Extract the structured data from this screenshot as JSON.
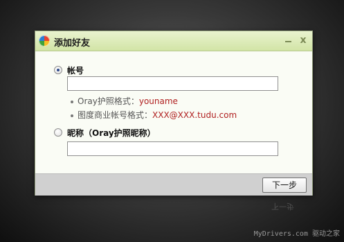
{
  "dialog": {
    "title": "添加好友",
    "app_icon": "app-logo-icon",
    "controls": {
      "minimize": "−",
      "close": "x"
    }
  },
  "form": {
    "option_account": {
      "label": "帐号",
      "selected": true,
      "input_value": "",
      "hints": [
        {
          "prefix": "Oray护照格式：",
          "value": "youname"
        },
        {
          "prefix": "图度商业帐号格式：",
          "value": "XXX@XXX.tudu.com"
        }
      ]
    },
    "option_nickname": {
      "label": "昵称（Oray护照昵称）",
      "selected": false,
      "input_value": ""
    }
  },
  "footer": {
    "next_label": "下一步"
  },
  "reflection_text": "下一步",
  "watermark": "MyDrivers.com 驱动之家",
  "colors": {
    "titlebar": "#d9e8b4",
    "hint_value": "#b02020",
    "footer": "#d0d0d0"
  }
}
